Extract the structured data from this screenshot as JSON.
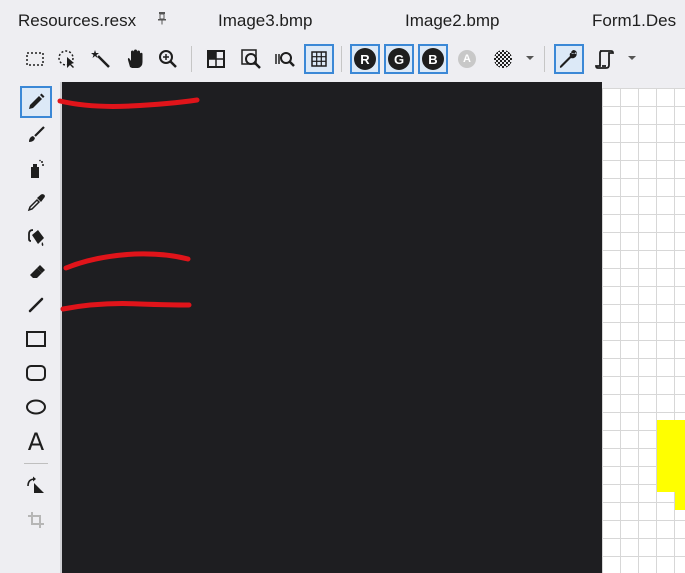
{
  "tabs": [
    {
      "label": "Resources.resx"
    },
    {
      "label": "Image3.bmp"
    },
    {
      "label": "Image2.bmp"
    },
    {
      "label": "Form1.Des"
    }
  ],
  "toolbar": {
    "channel_red": "R",
    "channel_green": "G",
    "channel_blue": "B",
    "channel_alpha": "A",
    "active_accent": "#3b88d6"
  },
  "palette": {
    "text_tool_glyph": "A",
    "selected_tool": "pencil-tool"
  },
  "canvas": {
    "background": "#1e1e21",
    "highlight_color": "#ffff00",
    "annotation_color": "#e0141a"
  }
}
